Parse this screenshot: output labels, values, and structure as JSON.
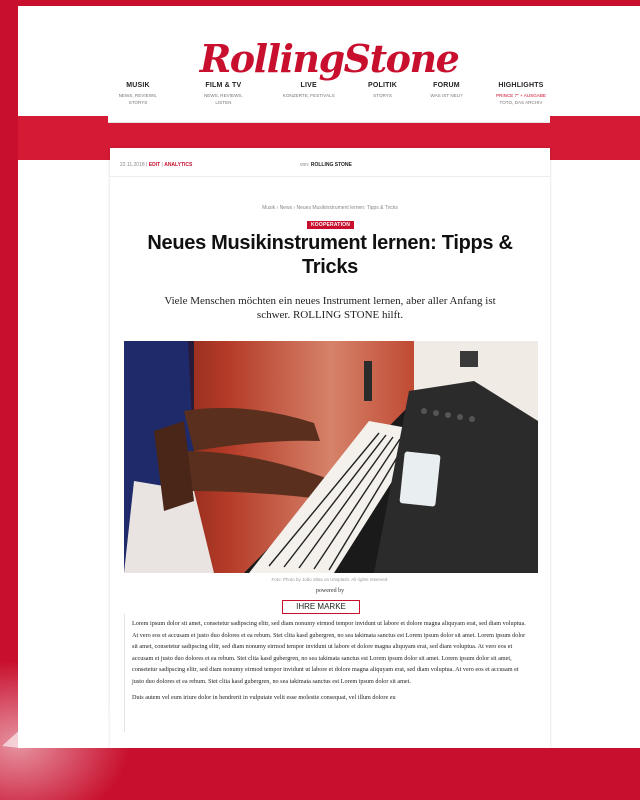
{
  "header": {
    "logo": "RollingStone",
    "nav": [
      {
        "title": "MUSIK",
        "sub": "NEWS, REVIEWS, STORYS"
      },
      {
        "title": "FILM & TV",
        "sub": "NEWS, REVIEWS, LISTEN"
      },
      {
        "title": "LIVE",
        "sub": "KONZERTE, FESTIVALS"
      },
      {
        "title": "POLITIK",
        "sub": "STORYS"
      },
      {
        "title": "FORUM",
        "sub": "WAS IST NEU?"
      },
      {
        "title": "HIGHLIGHTS",
        "sub": "PRINCE 7\" + AUSGABE",
        "sub2": "TOTO, DAS ARCHIV"
      }
    ]
  },
  "article": {
    "date": "22.11.2018",
    "edit": "EDIT",
    "analytics": "ANALYTICS",
    "author_prefix": "von:",
    "author": "ROLLING STONE",
    "breadcrumb": "Musik › News › Neues Musikinstrument lernen: Tipps & Tricks",
    "tag": "KOOPERATION",
    "title": "Neues Musikinstrument lernen: Tipps & Tricks",
    "subtitle": "Viele Menschen möchten ein neues Instrument lernen, aber aller Anfang ist schwer. ROLLING STONE hilft.",
    "caption": "Foto: Photo by João Silas on Unsplash. All rights reserved.",
    "powered_by": "powered by",
    "brand": "IHRE MARKE",
    "paragraphs": [
      "Lorem ipsum dolor sit amet, consetetur sadipscing elitr, sed diam nonumy eirmod tempor invidunt ut labore et dolore magna aliquyam erat, sed diam voluptua. At vero eos et accusam et justo duo dolores et ea rebum. Stet clita kasd gubergren, no sea takimata sanctus est Lorem ipsum dolor sit amet. Lorem ipsum dolor sit amet, consetetur sadipscing elitr, sed diam nonumy eirmod tempor invidunt ut labore et dolore magna aliquyam erat, sed diam voluptua. At vero eos et accusam et justo duo dolores et ea rebum. Stet clita kasd gubergren, no sea takimata sanctus est Lorem ipsum dolor sit amet. Lorem ipsum dolor sit amet, consetetur sadipscing elitr, sed diam nonumy eirmod tempor invidunt ut labore et dolore magna aliquyam erat, sed diam voluptua. At vero eos et accusam et justo duo dolores et ea rebum. Stet clita kasd gubergren, no sea takimata sanctus est Lorem ipsum dolor sit amet.",
      "Duis autem vel eum iriure dolor in hendrerit in vulputate velit esse molestie consequat, vel illum dolore eu"
    ]
  },
  "colors": {
    "brand_red": "#c8102e",
    "band_red": "#d51a36"
  }
}
